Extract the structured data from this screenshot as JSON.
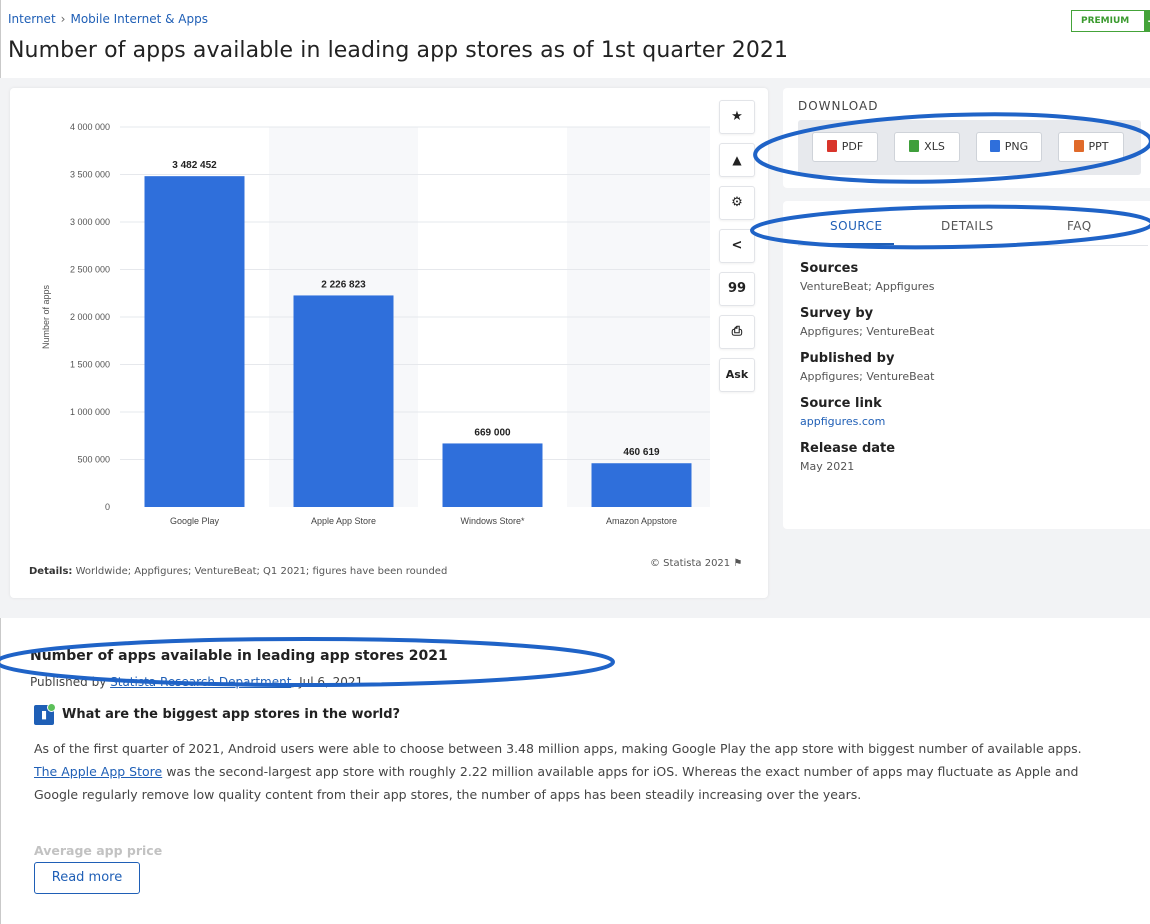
{
  "breadcrumb": {
    "item1": "Internet",
    "separator": "›",
    "item2": "Mobile Internet & Apps"
  },
  "premium": {
    "label": "PREMIUM",
    "plus": "+"
  },
  "page_title": "Number of apps available in leading app stores as of 1st quarter 2021",
  "toolbar": {
    "star": "★",
    "bell": "🔔",
    "gear": "⚙",
    "share": "<",
    "quote": "99",
    "print": "⎙",
    "ask": "Ask"
  },
  "chart_data": {
    "type": "bar",
    "categories": [
      "Google Play",
      "Apple App Store",
      "Windows Store*",
      "Amazon Appstore"
    ],
    "values": [
      3482452,
      2226823,
      669000,
      460619
    ],
    "value_labels": [
      "3 482 452",
      "2 226 823",
      "669 000",
      "460 619"
    ],
    "ylabel": "Number of apps",
    "ylim": [
      0,
      4000000
    ],
    "yticks": [
      0,
      500000,
      1000000,
      1500000,
      2000000,
      2500000,
      3000000,
      3500000,
      4000000
    ],
    "ytick_labels": [
      "0",
      "500 000",
      "1 000 000",
      "1 500 000",
      "2 000 000",
      "2 500 000",
      "3 000 000",
      "3 500 000",
      "4 000 000"
    ],
    "bar_color": "#2f6fdb",
    "grid": true
  },
  "chart_footer": {
    "details_label": "Details:",
    "details_text": " Worldwide; Appfigures; VentureBeat; Q1 2021; figures have been rounded",
    "copyright": "© Statista 2021"
  },
  "download": {
    "title": "DOWNLOAD",
    "buttons": [
      {
        "label": "PDF",
        "color": "#d9352b"
      },
      {
        "label": "XLS",
        "color": "#3f9f3b"
      },
      {
        "label": "PNG",
        "color": "#2f6fdb"
      },
      {
        "label": "PPT",
        "color": "#e06a2a"
      }
    ]
  },
  "source_tabs": {
    "source": "SOURCE",
    "details": "DETAILS",
    "faq": "FAQ",
    "active": "SOURCE"
  },
  "source_info": {
    "sources_head": "Sources",
    "sources_val": "VentureBeat; Appfigures",
    "survey_head": "Survey by",
    "survey_val": "Appfigures; VentureBeat",
    "published_head": "Published by",
    "published_val": "Appfigures; VentureBeat",
    "link_head": "Source link",
    "link_val": "appfigures.com",
    "release_head": "Release date",
    "release_val": "May 2021"
  },
  "article": {
    "title": "Number of apps available in leading app stores 2021",
    "published_prefix": "Published by ",
    "author": "Statista Research Department",
    "date": ", Jul 6, 2021",
    "question": "What are the biggest app stores in the world?",
    "para_part1": "As of the first quarter of 2021, Android users were able to choose between 3.48 million apps, making Google Play the app store with biggest number of available apps. ",
    "para_link": "The Apple App Store",
    "para_part2": " was the second-largest app store with roughly 2.22 million available apps for iOS. Whereas the exact number of apps may fluctuate as Apple and Google regularly remove low quality content from their app stores, the number of apps has been steadily increasing over the years.",
    "faded_heading": "Average app price",
    "read_more": "Read more"
  },
  "annotations": {
    "color": "#1f63c7"
  }
}
